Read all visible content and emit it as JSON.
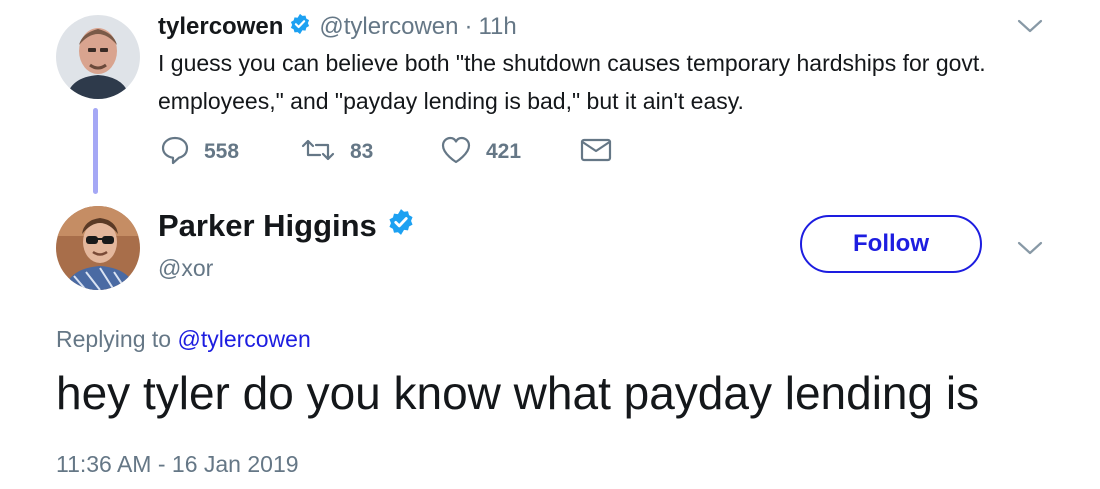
{
  "parent_tweet": {
    "name": "tylercowen",
    "handle": "@tylercowen",
    "separator": "·",
    "time": "11h",
    "text": "I guess you can believe both \"the shutdown causes temporary hardships for govt. employees,\" and \"payday lending is bad,\" but it ain't easy.",
    "replies": "558",
    "retweets": "83",
    "likes": "421"
  },
  "reply_tweet": {
    "name": "Parker Higgins",
    "handle": "@xor",
    "follow_label": "Follow",
    "replying_prefix": "Replying to",
    "replying_handle": "@tylercowen",
    "text": "hey tyler do you know what payday lending is",
    "timestamp": "11:36 AM - 16 Jan 2019"
  },
  "colors": {
    "accent": "#1d1de0",
    "verified": "#1da1f2",
    "muted": "#657786",
    "thread_line": "#a5a8f5"
  },
  "icons": {
    "reply": "speech-bubble-icon",
    "retweet": "retweet-icon",
    "like": "heart-icon",
    "message": "envelope-icon",
    "verified": "verified-badge-icon",
    "more": "chevron-down-icon"
  }
}
